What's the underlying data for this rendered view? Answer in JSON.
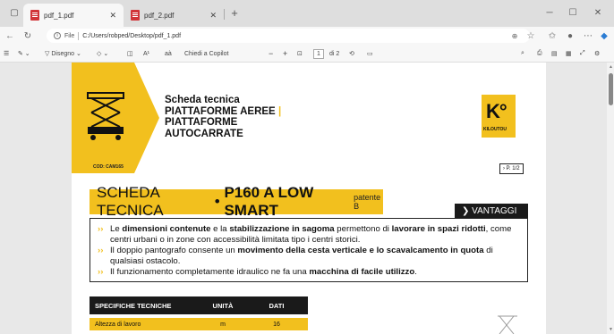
{
  "tabs": [
    {
      "label": "pdf_1.pdf",
      "active": true
    },
    {
      "label": "pdf_2.pdf",
      "active": false
    }
  ],
  "address": {
    "scheme": "File",
    "path": "C:/Users/robped/Desktop/pdf_1.pdf"
  },
  "pdf_toolbar": {
    "draw_label": "Disegno",
    "font_label": "A¹",
    "translate_label": "aà",
    "copilot_label": "Chiedi a Copilot",
    "zoom_minus": "−",
    "zoom_plus": "+",
    "page_current": "1",
    "page_total": "di 2"
  },
  "document": {
    "cod": "COD: CAM165",
    "title_line1": "Scheda tecnica",
    "title_line2": "PIATTAFORME AEREE",
    "title_line2_mark": "|",
    "title_line3": "PIATTAFORME",
    "title_line4": "AUTOCARRATE",
    "logo_letters": "K°",
    "logo_name": "KILOUTOU",
    "page_ref": "› P. 1/2",
    "banner_main": "SCHEDA TECNICA",
    "banner_dot": " • ",
    "banner_model": "P160 A LOW SMART",
    "banner_small": "patente B",
    "vantaggi": "❯ VANTAGGI",
    "advantages": [
      {
        "parts": [
          {
            "t": "Le ",
            "b": false
          },
          {
            "t": "dimensioni contenute",
            "b": true
          },
          {
            "t": " e la ",
            "b": false
          },
          {
            "t": "stabilizzazione in sagoma",
            "b": true
          },
          {
            "t": " permettono di ",
            "b": false
          },
          {
            "t": "lavorare in spazi ridotti",
            "b": true
          },
          {
            "t": ", come centri urbani o in zone con accessibilità limitata tipo i centri storici.",
            "b": false
          }
        ]
      },
      {
        "parts": [
          {
            "t": "Il doppio pantografo consente un ",
            "b": false
          },
          {
            "t": "movimento della cesta verticale e lo scavalcamento in quota",
            "b": true
          },
          {
            "t": " di qualsiasi ostacolo.",
            "b": false
          }
        ]
      },
      {
        "parts": [
          {
            "t": "Il funzionamento completamente idraulico ne fa una ",
            "b": false
          },
          {
            "t": "macchina di facile utilizzo",
            "b": true
          },
          {
            "t": ".",
            "b": false
          }
        ]
      }
    ],
    "spec_headers": [
      "SPECIFICHE TECNICHE",
      "UNITÀ",
      "DATI"
    ],
    "spec_rows": [
      [
        "Altezza di lavoro",
        "m",
        "16"
      ]
    ]
  },
  "colors": {
    "brand_yellow": "#f2c01e",
    "dark": "#1a1a1a"
  }
}
